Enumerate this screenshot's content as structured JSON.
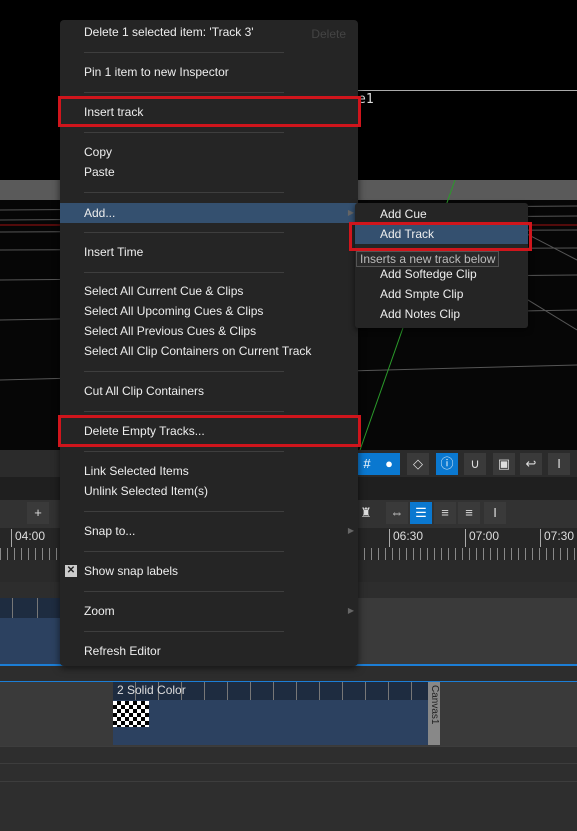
{
  "viewport": {
    "label": "e1"
  },
  "context_menu": {
    "items": [
      {
        "label": "Delete 1 selected item: 'Track 3'",
        "shortcut": "Delete"
      },
      {
        "label": "Pin 1 item to new Inspector"
      },
      {
        "label": "Insert track"
      },
      {
        "label": "Copy"
      },
      {
        "label": "Paste"
      },
      {
        "label": "Add..."
      },
      {
        "label": "Insert Time"
      },
      {
        "label": "Select All Current Cue & Clips"
      },
      {
        "label": "Select All Upcoming Cues & Clips"
      },
      {
        "label": "Select All Previous Cues & Clips"
      },
      {
        "label": "Select All Clip Containers on Current Track"
      },
      {
        "label": "Cut All Clip Containers"
      },
      {
        "label": "Delete Empty Tracks..."
      },
      {
        "label": "Link Selected Items"
      },
      {
        "label": "Unlink Selected Item(s)"
      },
      {
        "label": "Snap to..."
      },
      {
        "label": "Show snap labels",
        "checked": true
      },
      {
        "label": "Zoom"
      },
      {
        "label": "Refresh Editor"
      }
    ]
  },
  "submenu": {
    "items": [
      {
        "label": "Add Cue"
      },
      {
        "label": "Add Track"
      },
      {
        "label": "Add Softedge Clip"
      },
      {
        "label": "Add Smpte Clip"
      },
      {
        "label": "Add Notes Clip"
      }
    ],
    "tooltip": "Inserts a new track below"
  },
  "timeline": {
    "ruler_labels": [
      "04:00",
      "06:30",
      "07:00",
      "07:30"
    ],
    "clip_label": "2 Solid Color",
    "canvas_label": "Canvas1"
  },
  "colors": {
    "highlight": "#34506f",
    "annotation": "#d0151c",
    "accent": "#0a78d0"
  }
}
